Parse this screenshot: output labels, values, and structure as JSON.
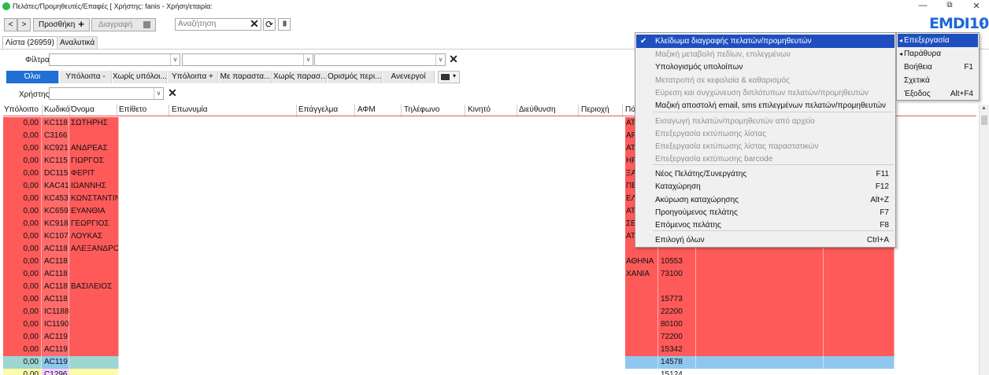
{
  "window": {
    "title": "Πελάτες/Προμηθευτές/Επαφές  [ Χρήστης: fanis - Χρήση/εταιρία:",
    "logo": "EMDI10",
    "minimize": "—",
    "restore": "⧉",
    "close": "✕"
  },
  "toolbar": {
    "back": "<",
    "forward": ">",
    "add_label": "Προσθήκη",
    "add_symbol": "+",
    "delete_label": "Διαγραφή",
    "search_placeholder": "Αναζήτηση",
    "clear": "✕",
    "refresh": "⟳",
    "barcode": "|||||"
  },
  "tabs": [
    {
      "label": "Λίστα (26959)"
    },
    {
      "label": "Αναλυτικά"
    }
  ],
  "filters": {
    "filter_label": "Φίλτρα",
    "clear": "✕",
    "buttons": [
      "Όλοι",
      "Υπόλοιπα -",
      "Χωρίς υπόλοι...",
      "Υπόλοιπα +",
      "Με παραστα...",
      "Χωρίς παρασ...",
      "Ορισμός περι...",
      "Ανενεργοί"
    ],
    "user_label": "Χρήστης",
    "user_clear": "✕"
  },
  "grid": {
    "headers": [
      "Υπόλοιπο",
      "Κωδικό",
      "Όνομα",
      "Επίθετο",
      "Επωνυμία",
      "Επάγγελμα",
      "ΑΦΜ",
      "Τηλέφωνο",
      "Κινητό",
      "Διεύθυνση",
      "Περιοχή",
      "Πό"
    ],
    "rows": [
      {
        "balance": "0,00",
        "code": "KC118",
        "name": "ΣΩΤΗΡΗΣ",
        "city": "AT",
        "zip": "",
        "style": "red"
      },
      {
        "balance": "0,00",
        "code": "C3166",
        "name": "",
        "city": "AF",
        "zip": "",
        "style": "red"
      },
      {
        "balance": "0,00",
        "code": "KC921",
        "name": "ΑΝΔΡΕΑΣ",
        "city": "AT",
        "zip": "",
        "style": "red"
      },
      {
        "balance": "0,00",
        "code": "KC115",
        "name": "ΓΙΩΡΓΟΣ",
        "city": "HF",
        "zip": "",
        "style": "red"
      },
      {
        "balance": "0,00",
        "code": "DC115",
        "name": "ΦΕΡΙΤ",
        "city": "ΞΑ",
        "zip": "",
        "style": "red"
      },
      {
        "balance": "0,00",
        "code": "KAC41",
        "name": "ΙΩΑΝΝΗΣ",
        "city": "ΠΕ",
        "zip": "",
        "style": "red"
      },
      {
        "balance": "0,00",
        "code": "KC453",
        "name": "ΚΩΝΣΤΑΝΤΙΝ",
        "city": "ΕΛ",
        "zip": "",
        "style": "red"
      },
      {
        "balance": "0,00",
        "code": "KC659",
        "name": "ΕΥΑΝΘΙΑ",
        "city": "AT",
        "zip": "",
        "style": "red"
      },
      {
        "balance": "0,00",
        "code": "KC918",
        "name": "ΓΕΩΡΓΙΟΣ",
        "city": "ΣΕ",
        "zip": "",
        "style": "red"
      },
      {
        "balance": "0,00",
        "code": "KC107",
        "name": "ΛΟΥΚΑΣ",
        "city": "AT",
        "zip": "",
        "style": "red"
      },
      {
        "balance": "0,00",
        "code": "AC118",
        "name": "ΑΛΕΞΑΝΔΡΟ",
        "city": "",
        "zip": "",
        "style": "red"
      },
      {
        "balance": "0,00",
        "code": "AC118",
        "name": "",
        "city": "ΑΘΗΝΑ",
        "zip": "10553",
        "style": "red"
      },
      {
        "balance": "0,00",
        "code": "AC118",
        "name": "",
        "city": "ΧΑΝΙΑ",
        "zip": "73100",
        "style": "red"
      },
      {
        "balance": "0,00",
        "code": "AC118",
        "name": "ΒΑΣΙΛΕΙΟΣ",
        "city": "",
        "zip": "",
        "style": "red"
      },
      {
        "balance": "0,00",
        "code": "AC118",
        "name": "",
        "city": "",
        "zip": "15773",
        "style": "red"
      },
      {
        "balance": "0,00",
        "code": "IC1188",
        "name": "",
        "city": "",
        "zip": "22200",
        "style": "red"
      },
      {
        "balance": "0,00",
        "code": "IC1190",
        "name": "",
        "city": "",
        "zip": "80100",
        "style": "red"
      },
      {
        "balance": "0,00",
        "code": "AC119",
        "name": "",
        "city": "",
        "zip": "72200",
        "style": "red"
      },
      {
        "balance": "0,00",
        "code": "AC119",
        "name": "",
        "city": "",
        "zip": "15342",
        "style": "red"
      },
      {
        "balance": "0,00",
        "code": "AC119",
        "name": "",
        "city": "",
        "zip": "14578",
        "style": "blue"
      },
      {
        "balance": "0,00",
        "code": "C1296",
        "name": "",
        "city": "",
        "zip": "15124",
        "style": "yellow"
      }
    ]
  },
  "menu": {
    "items": [
      {
        "label": "Κλείδωμα διαγραφής πελατών/προμηθευτών",
        "key": "",
        "checked": "✔",
        "state": "selected"
      },
      {
        "label": "Μαζική μεταβολή πεδίων, επιλεγμένων",
        "key": "",
        "state": "disabled"
      },
      {
        "label": "Υπολογισμός υπολοίπων",
        "key": "",
        "state": "enabled"
      },
      {
        "label": "Μετατροπή σε κεφαλαία & καθαρισμός",
        "key": "",
        "state": "disabled"
      },
      {
        "label": "Εύρεση και συγχώνευση διπλότυπων πελατών/προμηθευτών",
        "key": "",
        "state": "disabled"
      },
      {
        "label": "Μαζική αποστολή email, sms επιλεγμένων πελατών/προμηθευτών",
        "key": "",
        "state": "enabled"
      },
      {
        "label": "Εισαγωγή πελατών/προμηθευτών από αρχείο",
        "key": "",
        "state": "disabled"
      },
      {
        "label": "Επεξεργασία εκτύπωσης λίστας",
        "key": "",
        "state": "disabled"
      },
      {
        "label": "Επεξεργασία εκτύπωσης λίστας παραστατικών",
        "key": "",
        "state": "disabled"
      },
      {
        "label": "Επεξεργασία εκτύπωσης barcode",
        "key": "",
        "state": "disabled"
      },
      {
        "label": "Νέος Πελάτης/Συνεργάτης",
        "key": "F11",
        "state": "enabled"
      },
      {
        "label": "Καταχώρηση",
        "key": "F12",
        "state": "enabled"
      },
      {
        "label": "Ακύρωση καταχώρησης",
        "key": "Alt+Z",
        "state": "enabled"
      },
      {
        "label": "Προηγούμενος πελάτης",
        "key": "F7",
        "state": "enabled"
      },
      {
        "label": "Επόμενος πελάτης",
        "key": "F8",
        "state": "enabled"
      },
      {
        "label": "Επιλογή όλων",
        "key": "Ctrl+A",
        "state": "enabled"
      }
    ]
  },
  "submenu": {
    "items": [
      {
        "label": "Επεξεργασία",
        "key": "",
        "arrow": "◂",
        "state": "selected"
      },
      {
        "label": "Παράθυρα",
        "key": "",
        "arrow": "◂",
        "state": "enabled"
      },
      {
        "label": "Βοήθεια",
        "key": "F1",
        "arrow": "",
        "state": "enabled"
      },
      {
        "label": "Σχετικά",
        "key": "",
        "arrow": "",
        "state": "enabled"
      },
      {
        "label": "Έξοδος",
        "key": "Alt+F4",
        "arrow": "",
        "state": "enabled"
      }
    ]
  },
  "colors": {
    "red_row": "#ff5a5a",
    "red_code": "#ff6a6a",
    "blue_row": "#8fc7ee",
    "yellow_row": "#fffaa8",
    "pink_row": "#f7d0ff",
    "accent": "#1f4fbf",
    "filter_all": "#1f6fd6"
  }
}
